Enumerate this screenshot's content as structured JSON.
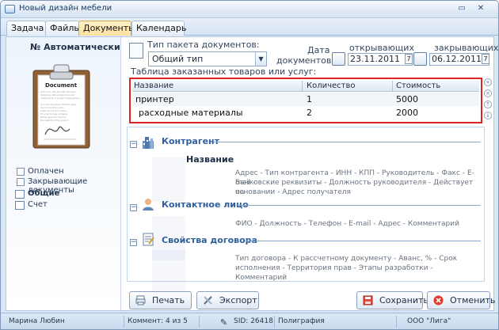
{
  "window": {
    "title": "Новый дизайн мебели"
  },
  "tabs": [
    "Задача",
    "Файлы",
    "Документы",
    "Календарь"
  ],
  "left": {
    "number_label": "№ Автоматически",
    "document_title": "Document",
    "document_text": [
      "At its core, tom-phonetic has been",
      "designing cutting edge icons and",
      "interfaces for a variety of applications.",
      "",
      "Icon arts has proven that it's really",
      "much more than just a",
      "pretty face to the market.",
      "It's a technology company",
      "whose goal is to improve",
      "the usability of the product."
    ],
    "checks": [
      "Оплачен",
      "Закрывающие документы"
    ],
    "links": [
      "Общие",
      "Счет"
    ]
  },
  "form": {
    "package_label": "Тип пакета документов:",
    "package_value": "Общий тип",
    "date_label": [
      "Дата",
      "документов"
    ],
    "opening_label": "открывающих",
    "opening_date": "23.11.2011",
    "closing_label": "закрывающих",
    "closing_date": "06.12.2011",
    "ordered_label": "Таблица заказанных товаров или услуг:"
  },
  "table": {
    "headers": [
      "Название",
      "Количество",
      "Стоимость"
    ],
    "rows": [
      [
        "принтер",
        "1",
        "5000"
      ],
      [
        "расходные материалы",
        "2",
        "2000"
      ]
    ]
  },
  "sections": [
    {
      "title": "Контрагент",
      "name": "Название",
      "description": [
        "Адрес - Тип контрагента - ИНН - КПП - Руководитель - Факс - E-mail -",
        "Банковские реквизиты - Должность руководителя - Действует на",
        "основании - Адрес получателя"
      ]
    },
    {
      "title": "Контактное лицо",
      "description": [
        "ФИО - Должность - Телефон - E-mail - Адрес - Комментарий"
      ]
    },
    {
      "title": "Свойства договора",
      "description": [
        "Тип договора - К рассчетному документу - Аванс, % - Срок",
        "исполнения - Территория прав - Этапы разработки - Комментарий"
      ]
    }
  ],
  "buttons": {
    "print": "Печать",
    "export": "Экспорт",
    "save": "Сохранить",
    "cancel": "Отменить"
  },
  "status": {
    "user": "Марина Любин",
    "comments": "Коммент: 4 из 5",
    "sid": "SID: 26418",
    "category": "Полиграфия",
    "company": "ООО \"Лига\""
  }
}
